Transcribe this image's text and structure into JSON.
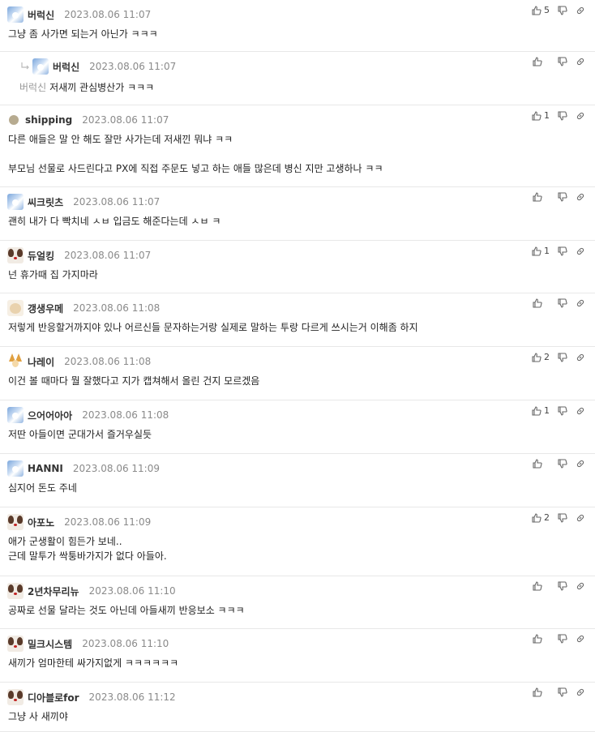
{
  "comments": [
    {
      "name": "버럭신",
      "date": "2023.08.06 11:07",
      "avatar": "blue-avatar",
      "lines": [
        "그냥 좀 사가면 되는거 아닌가 ㅋㅋㅋ"
      ],
      "likes": "5",
      "reply": false
    },
    {
      "name": "버럭신",
      "date": "2023.08.06 11:07",
      "avatar": "blue-avatar",
      "mention": "버럭신",
      "lines": [
        "저새끼 관심병산가 ㅋㅋㅋ"
      ],
      "likes": "",
      "reply": true
    },
    {
      "name": "shipping",
      "date": "2023.08.06 11:07",
      "avatar": "dot-avatar",
      "lines": [
        "다른 애들은 말 안 해도 잘만 사가는데 저새낀 뭐냐 ㅋㅋ",
        "",
        "부모님 선물로 사드린다고 PX에 직접 주문도 넣고 하는 애들 많은데 병신 지만 고생하나 ㅋㅋ"
      ],
      "likes": "1",
      "reply": false
    },
    {
      "name": "씨크릿츠",
      "date": "2023.08.06 11:07",
      "avatar": "blue-avatar",
      "lines": [
        "괜히 내가 다 빡치네 ㅅㅂ 입금도 해준다는데 ㅅㅂ ㅋ"
      ],
      "likes": "",
      "reply": false
    },
    {
      "name": "듀얼킹",
      "date": "2023.08.06 11:07",
      "avatar": "dog-avatar",
      "lines": [
        "넌 휴가때 집 가지마라"
      ],
      "likes": "1",
      "reply": false
    },
    {
      "name": "갱생우메",
      "date": "2023.08.06 11:08",
      "avatar": "puppy-avatar",
      "lines": [
        "저렇게 반응할거까지야 있나 어르신들 문자하는거랑 실제로 말하는 투랑 다르게 쓰시는거 이해좀 하지"
      ],
      "likes": "",
      "reply": false
    },
    {
      "name": "나레이",
      "date": "2023.08.06 11:08",
      "avatar": "fox-avatar",
      "lines": [
        "이건 볼 때마다 뭘 잘했다고 지가 캡쳐해서 올린 건지 모르겠음"
      ],
      "likes": "2",
      "reply": false
    },
    {
      "name": "으어어아아",
      "date": "2023.08.06 11:08",
      "avatar": "blue-avatar",
      "lines": [
        "저딴 아들이면 군대가서 즐거우실듯"
      ],
      "likes": "1",
      "reply": false
    },
    {
      "name": "HANNI",
      "date": "2023.08.06 11:09",
      "avatar": "blue-avatar",
      "lines": [
        "심지어 돈도 주네"
      ],
      "likes": "",
      "reply": false
    },
    {
      "name": "아포노",
      "date": "2023.08.06 11:09",
      "avatar": "dog-avatar",
      "lines": [
        "애가 군생활이 힘든가 보네..",
        "근데 말투가 싹퉁바가지가 없다 아들아."
      ],
      "likes": "2",
      "reply": false
    },
    {
      "name": "2년차무리뉴",
      "date": "2023.08.06 11:10",
      "avatar": "dog-avatar",
      "lines": [
        "공짜로 선물 달라는 것도 아닌데 아들새끼 반응보소 ㅋㅋㅋ"
      ],
      "likes": "",
      "reply": false
    },
    {
      "name": "밀크시스템",
      "date": "2023.08.06 11:10",
      "avatar": "dog-avatar",
      "lines": [
        "새끼가 엄마한테 싸가지없게 ㅋㅋㅋㅋㅋㅋ"
      ],
      "likes": "",
      "reply": false
    },
    {
      "name": "디아블로for",
      "date": "2023.08.06 11:12",
      "avatar": "dog-avatar",
      "lines": [
        "그냥 사 새끼야"
      ],
      "likes": "",
      "reply": false
    }
  ]
}
